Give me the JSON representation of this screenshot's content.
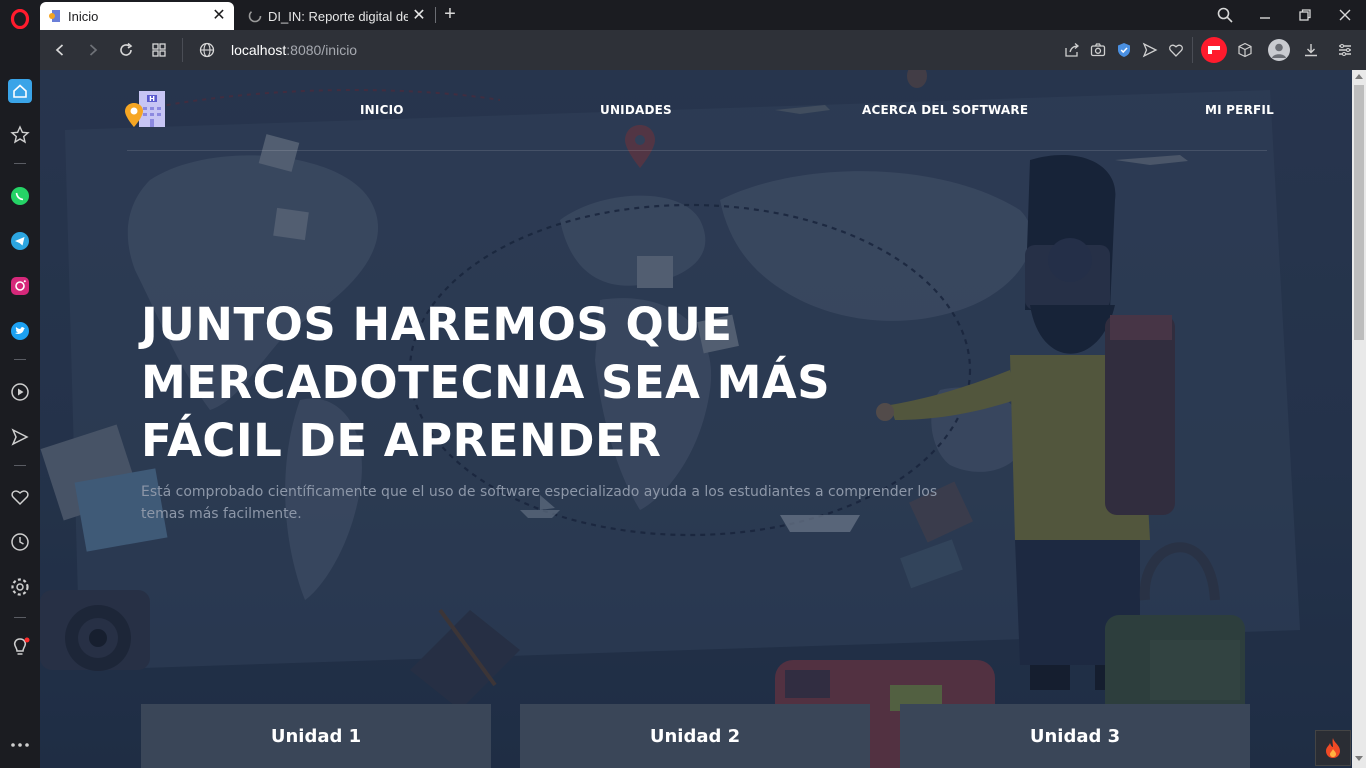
{
  "browser": {
    "tabs": [
      {
        "title": "Inicio",
        "active": true
      },
      {
        "title": "DI_IN: Reporte digital de pr",
        "active": false
      }
    ],
    "new_tab_label": "+",
    "url_host": "localhost",
    "url_path": ":8080/inicio"
  },
  "site": {
    "nav": [
      "INICIO",
      "UNIDADES",
      "ACERCA DEL SOFTWARE",
      "MI PERFIL"
    ],
    "hero_title": "JUNTOS HAREMOS QUE MERCADOTECNIA SEA MÁS FÁCIL DE APRENDER",
    "hero_subtitle": "Está comprobado científicamente que el uso de software especializado ayuda a los estudiantes a comprender los temas más facilmente.",
    "units": [
      "Unidad 1",
      "Unidad 2",
      "Unidad 3"
    ]
  },
  "colors": {
    "opera_red": "#ff1b2d",
    "sidebar_bg": "#1b1c21",
    "addressbar_bg": "#2e3138",
    "page_bg": "#2c3a52",
    "card_bg": "#3a4658"
  },
  "icons": {
    "sidebar": [
      "opera-logo-icon",
      "home-icon",
      "star-icon",
      "whatsapp-icon",
      "telegram-icon",
      "instagram-icon",
      "twitter-icon",
      "player-icon",
      "send-icon",
      "heart-icon",
      "history-icon",
      "settings-icon",
      "lightbulb-icon",
      "more-icon"
    ],
    "toolbar": [
      "share-icon",
      "camera-icon",
      "shield-icon",
      "send-icon",
      "heart-icon",
      "extension-icon",
      "cube-icon",
      "profile-icon",
      "download-icon",
      "menu-icon"
    ]
  }
}
